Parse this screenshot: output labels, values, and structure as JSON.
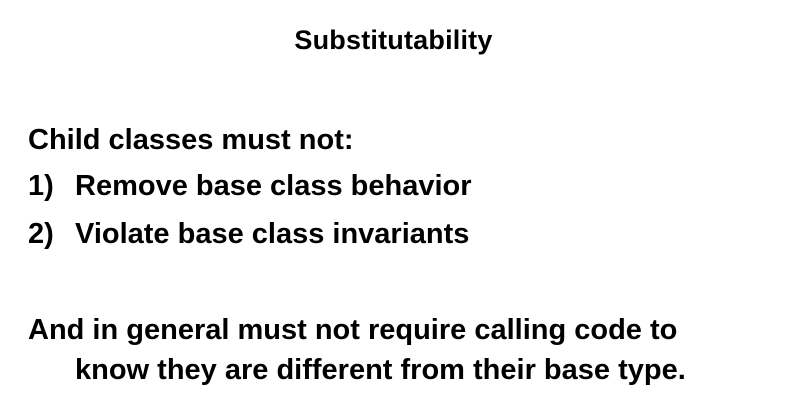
{
  "slide": {
    "title": "Substitutability",
    "intro": "Child classes must not:",
    "rules": [
      {
        "number": "1)",
        "text": "Remove base class behavior"
      },
      {
        "number": "2)",
        "text": "Violate base class invariants"
      }
    ],
    "summary": {
      "line1": "And in general must not require calling code to",
      "line2": "know they are different from their base type."
    },
    "colors": {
      "background": "#ffffff",
      "text": "#000000"
    }
  }
}
